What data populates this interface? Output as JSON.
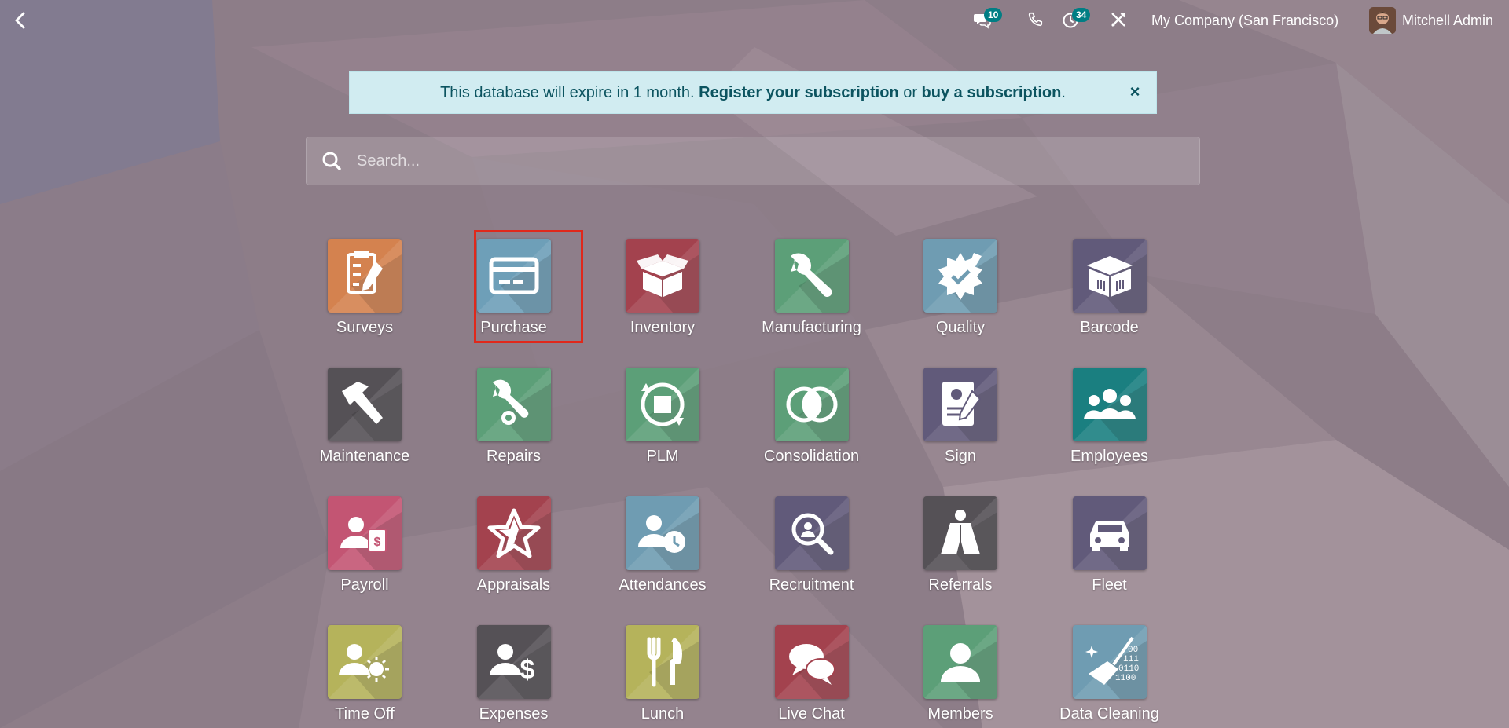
{
  "topbar": {
    "back_icon": "chevron-left-icon",
    "messages": {
      "icon": "chat-bubbles-icon",
      "count": "10"
    },
    "phone": {
      "icon": "phone-icon"
    },
    "activities": {
      "icon": "clock-icon",
      "count": "34"
    },
    "debug": {
      "icon": "tools-icon"
    },
    "company": "My Company (San Francisco)",
    "user": "Mitchell Admin"
  },
  "alert": {
    "text_before": "This database will expire in 1 month. ",
    "register_link": "Register your subscription",
    "middle": " or ",
    "buy_link": "buy a subscription",
    "end": ".",
    "close": "×"
  },
  "search": {
    "placeholder": "Search..."
  },
  "apps": [
    {
      "label": "Surveys",
      "color": "#d4824f",
      "icon": "survey-clipboard-icon"
    },
    {
      "label": "Purchase",
      "color": "#6e9fb8",
      "icon": "credit-card-icon"
    },
    {
      "label": "Inventory",
      "color": "#a3424e",
      "icon": "open-box-icon"
    },
    {
      "label": "Manufacturing",
      "color": "#5c9f78",
      "icon": "wrench-icon"
    },
    {
      "label": "Quality",
      "color": "#6f9cb2",
      "icon": "quality-seal-icon"
    },
    {
      "label": "Barcode",
      "color": "#615a7a",
      "icon": "barcode-box-icon"
    },
    {
      "label": "Maintenance",
      "color": "#555156",
      "icon": "hammer-icon"
    },
    {
      "label": "Repairs",
      "color": "#5c9f78",
      "icon": "wrench-gear-icon"
    },
    {
      "label": "PLM",
      "color": "#5c9f78",
      "icon": "cycle-box-icon"
    },
    {
      "label": "Consolidation",
      "color": "#5c9f78",
      "icon": "overlapping-circles-icon"
    },
    {
      "label": "Sign",
      "color": "#615a7a",
      "icon": "signature-document-icon"
    },
    {
      "label": "Employees",
      "color": "#1a7f80",
      "icon": "people-group-icon"
    },
    {
      "label": "Payroll",
      "color": "#c35573",
      "icon": "person-payslip-icon"
    },
    {
      "label": "Appraisals",
      "color": "#a3424e",
      "icon": "star-icon"
    },
    {
      "label": "Attendances",
      "color": "#6f9cb2",
      "icon": "person-clock-icon"
    },
    {
      "label": "Recruitment",
      "color": "#615a7a",
      "icon": "magnifier-person-icon"
    },
    {
      "label": "Referrals",
      "color": "#555156",
      "icon": "hero-cape-icon"
    },
    {
      "label": "Fleet",
      "color": "#615a7a",
      "icon": "car-icon"
    },
    {
      "label": "Time Off",
      "color": "#b5b35b",
      "icon": "person-sun-icon"
    },
    {
      "label": "Expenses",
      "color": "#555156",
      "icon": "person-dollar-icon"
    },
    {
      "label": "Lunch",
      "color": "#b5b35b",
      "icon": "fork-knife-icon"
    },
    {
      "label": "Live Chat",
      "color": "#a3424e",
      "icon": "chat-bubbles-icon"
    },
    {
      "label": "Members",
      "color": "#5c9f78",
      "icon": "person-icon"
    },
    {
      "label": "Data Cleaning",
      "color": "#6f9cb2",
      "icon": "broom-binary-icon"
    }
  ]
}
